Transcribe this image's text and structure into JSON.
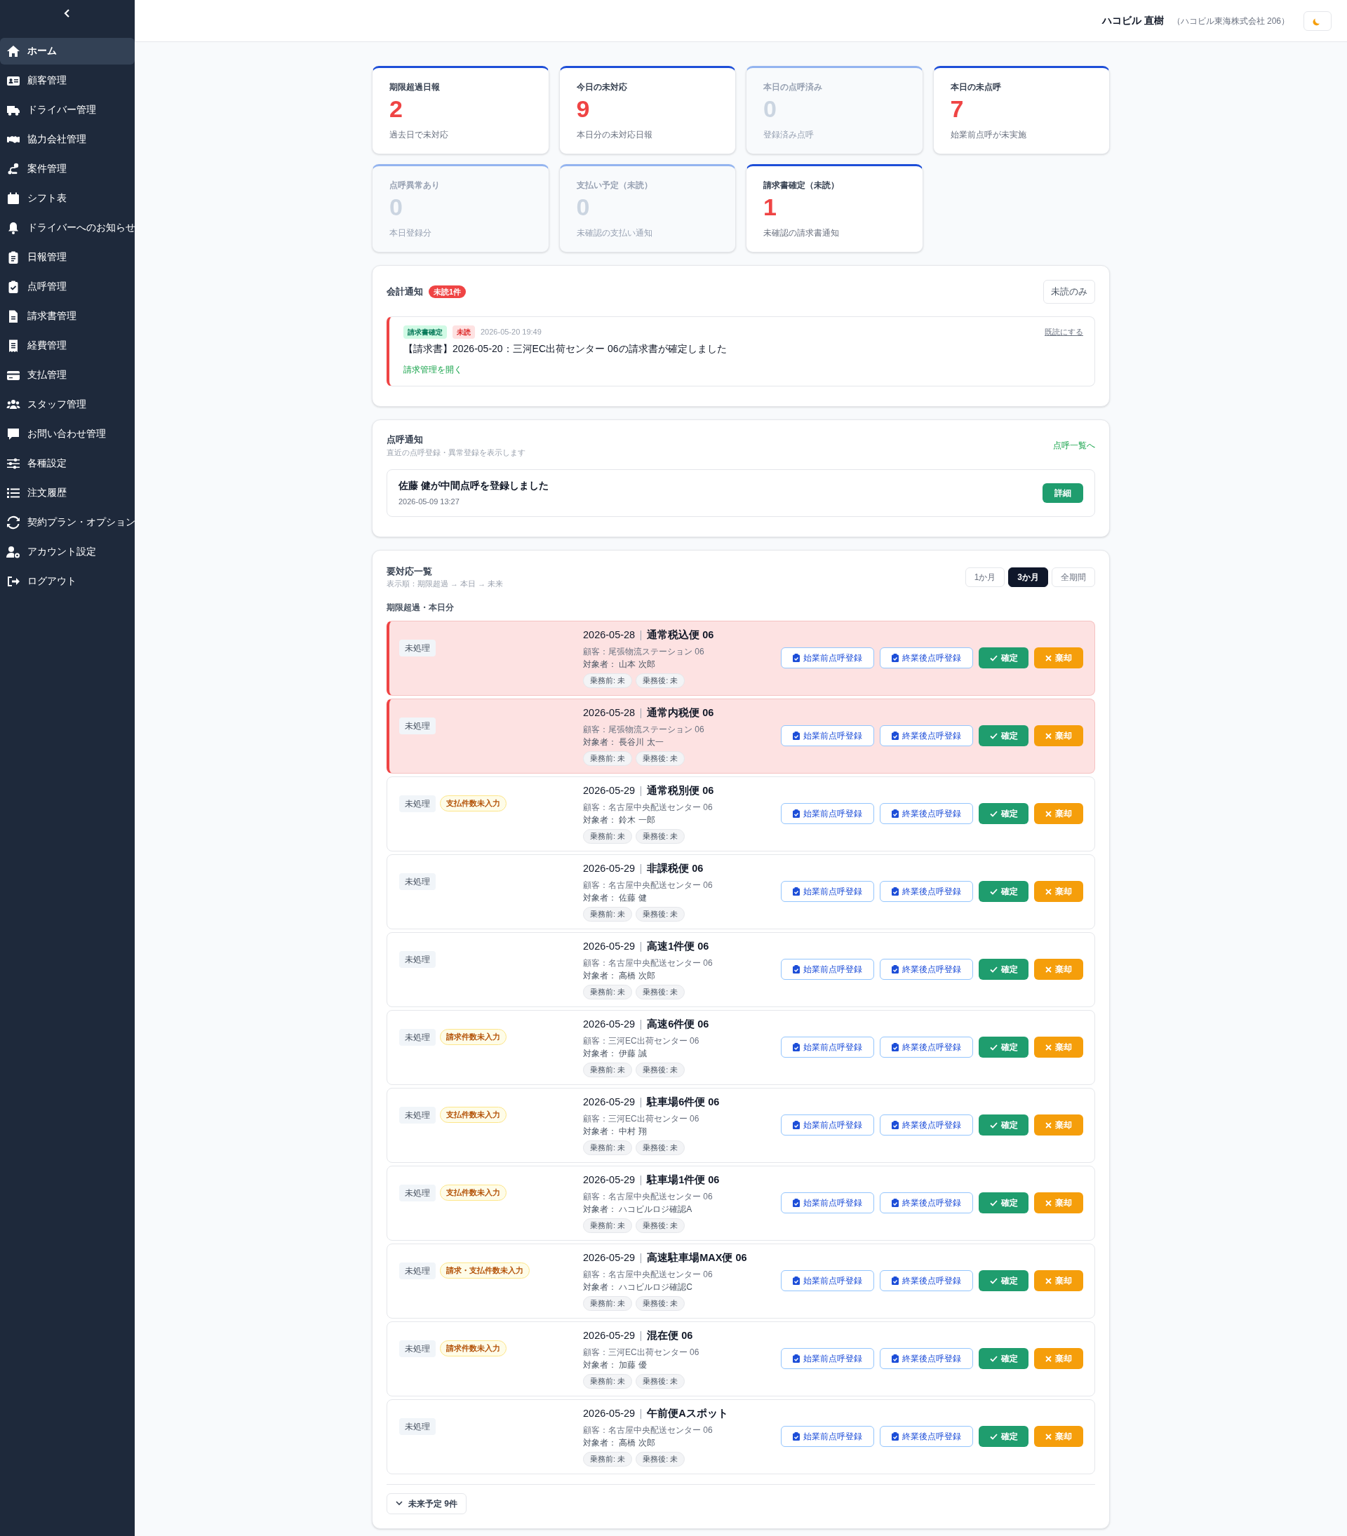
{
  "sidebar": {
    "items": [
      {
        "label": "ホーム",
        "selected": true
      },
      {
        "label": "顧客管理",
        "selected": false
      },
      {
        "label": "ドライバー管理",
        "selected": false
      },
      {
        "label": "協力会社管理",
        "selected": false
      },
      {
        "label": "案件管理",
        "selected": false
      },
      {
        "label": "シフト表",
        "selected": false
      },
      {
        "label": "ドライバーへのお知らせ",
        "selected": false
      },
      {
        "label": "日報管理",
        "selected": false
      },
      {
        "label": "点呼管理",
        "selected": false
      },
      {
        "label": "請求書管理",
        "selected": false
      },
      {
        "label": "経費管理",
        "selected": false
      },
      {
        "label": "支払管理",
        "selected": false
      },
      {
        "label": "スタッフ管理",
        "selected": false
      },
      {
        "label": "お問い合わせ管理",
        "selected": false
      },
      {
        "label": "各種設定",
        "selected": false
      },
      {
        "label": "注文履歴",
        "selected": false
      },
      {
        "label": "契約プラン・オプション",
        "selected": false
      },
      {
        "label": "アカウント設定",
        "selected": false
      },
      {
        "label": "ログアウト",
        "selected": false
      }
    ]
  },
  "header": {
    "user_name": "ハコビル 直樹",
    "company": "（ハコビル東海株式会社 206）"
  },
  "stats": [
    {
      "label": "期限超過日報",
      "value": "2",
      "note": "過去日で未対応",
      "active": true
    },
    {
      "label": "今日の未対応",
      "value": "9",
      "note": "本日分の未対応日報",
      "active": true
    },
    {
      "label": "本日の点呼済み",
      "value": "0",
      "note": "登録済み点呼",
      "active": false
    },
    {
      "label": "本日の未点呼",
      "value": "7",
      "note": "始業前点呼が未実施",
      "active": true
    },
    {
      "label": "点呼異常あり",
      "value": "0",
      "note": "本日登録分",
      "active": false
    },
    {
      "label": "支払い予定（未読）",
      "value": "0",
      "note": "未確認の支払い通知",
      "active": false
    },
    {
      "label": "請求書確定（未読）",
      "value": "1",
      "note": "未確認の請求書通知",
      "active": true
    }
  ],
  "accounting": {
    "title": "会計通知",
    "badge": "未読1件",
    "filter_button": "未読のみ",
    "notifications": [
      {
        "unread": true,
        "tags": [
          "請求書確定",
          "未読"
        ],
        "time": "2026-05-20 19:49",
        "mark_read": "既読にする",
        "message": "【請求書】2026-05-20：三河EC出荷センター 06の請求書が確定しました",
        "link": "請求管理を開く"
      }
    ]
  },
  "tenko": {
    "title": "点呼通知",
    "subtitle": "直近の点呼登録・異常登録を表示します",
    "link": "点呼一覧へ",
    "items": [
      {
        "text": "佐藤 健が中間点呼を登録しました",
        "time": "2026-05-09 13:27",
        "button": "詳細"
      }
    ]
  },
  "todo": {
    "title": "要対応一覧",
    "subtitle": "表示順：期限超過 → 本日 → 未来",
    "periods": [
      {
        "label": "1か月",
        "selected": false
      },
      {
        "label": "3か月",
        "selected": true
      },
      {
        "label": "全期間",
        "selected": false
      }
    ],
    "section": "期限超過・本日分",
    "rows": [
      {
        "overdue": true,
        "status": "未処理",
        "date": "2026-05-28",
        "title": "通常税込便 06",
        "customer": "顧客：尾張物流ステーション 06",
        "target": "対象者： 山本 次郎",
        "chips": [
          "乗務前: 未",
          "乗務後: 未"
        ],
        "actions": [
          "始業前点呼登録",
          "終業後点呼登録",
          "確定",
          "棄却"
        ]
      },
      {
        "overdue": true,
        "status": "未処理",
        "date": "2026-05-28",
        "title": "通常内税便 06",
        "customer": "顧客：尾張物流ステーション 06",
        "target": "対象者： 長谷川 太一",
        "chips": [
          "乗務前: 未",
          "乗務後: 未"
        ],
        "actions": [
          "始業前点呼登録",
          "終業後点呼登録",
          "確定",
          "棄却"
        ]
      },
      {
        "overdue": false,
        "status": "未処理",
        "tag": "支払件数未入力",
        "date": "2026-05-29",
        "title": "通常税別便 06",
        "customer": "顧客：名古屋中央配送センター 06",
        "target": "対象者： 鈴木 一郎",
        "chips": [
          "乗務前: 未",
          "乗務後: 未"
        ],
        "actions": [
          "始業前点呼登録",
          "終業後点呼登録",
          "確定",
          "棄却"
        ]
      },
      {
        "overdue": false,
        "status": "未処理",
        "date": "2026-05-29",
        "title": "非課税便 06",
        "customer": "顧客：名古屋中央配送センター 06",
        "target": "対象者： 佐藤 健",
        "chips": [
          "乗務前: 未",
          "乗務後: 未"
        ],
        "actions": [
          "始業前点呼登録",
          "終業後点呼登録",
          "確定",
          "棄却"
        ]
      },
      {
        "overdue": false,
        "status": "未処理",
        "date": "2026-05-29",
        "title": "高速1件便 06",
        "customer": "顧客：名古屋中央配送センター 06",
        "target": "対象者： 高橋 次郎",
        "chips": [
          "乗務前: 未",
          "乗務後: 未"
        ],
        "actions": [
          "始業前点呼登録",
          "終業後点呼登録",
          "確定",
          "棄却"
        ]
      },
      {
        "overdue": false,
        "status": "未処理",
        "tag": "請求件数未入力",
        "date": "2026-05-29",
        "title": "高速6件便 06",
        "customer": "顧客：三河EC出荷センター 06",
        "target": "対象者： 伊藤 誠",
        "chips": [
          "乗務前: 未",
          "乗務後: 未"
        ],
        "actions": [
          "始業前点呼登録",
          "終業後点呼登録",
          "確定",
          "棄却"
        ]
      },
      {
        "overdue": false,
        "status": "未処理",
        "tag": "支払件数未入力",
        "date": "2026-05-29",
        "title": "駐車場6件便 06",
        "customer": "顧客：三河EC出荷センター 06",
        "target": "対象者： 中村 翔",
        "chips": [
          "乗務前: 未",
          "乗務後: 未"
        ],
        "actions": [
          "始業前点呼登録",
          "終業後点呼登録",
          "確定",
          "棄却"
        ]
      },
      {
        "overdue": false,
        "status": "未処理",
        "tag": "支払件数未入力",
        "date": "2026-05-29",
        "title": "駐車場1件便 06",
        "customer": "顧客：名古屋中央配送センター 06",
        "target": "対象者： ハコビルロジ確認A",
        "chips": [
          "乗務前: 未",
          "乗務後: 未"
        ],
        "actions": [
          "始業前点呼登録",
          "終業後点呼登録",
          "確定",
          "棄却"
        ]
      },
      {
        "overdue": false,
        "status": "未処理",
        "tag": "請求・支払件数未入力",
        "date": "2026-05-29",
        "title": "高速駐車場MAX便 06",
        "customer": "顧客：名古屋中央配送センター 06",
        "target": "対象者： ハコビルロジ確認C",
        "chips": [
          "乗務前: 未",
          "乗務後: 未"
        ],
        "actions": [
          "始業前点呼登録",
          "終業後点呼登録",
          "確定",
          "棄却"
        ]
      },
      {
        "overdue": false,
        "status": "未処理",
        "tag": "請求件数未入力",
        "date": "2026-05-29",
        "title": "混在便 06",
        "customer": "顧客：三河EC出荷センター 06",
        "target": "対象者： 加藤 優",
        "chips": [
          "乗務前: 未",
          "乗務後: 未"
        ],
        "actions": [
          "始業前点呼登録",
          "終業後点呼登録",
          "確定",
          "棄却"
        ]
      },
      {
        "overdue": false,
        "status": "未処理",
        "date": "2026-05-29",
        "title": "午前便Aスポット",
        "customer": "顧客：名古屋中央配送センター 06",
        "target": "対象者： 高橋 次郎",
        "chips": [
          "乗務前: 未",
          "乗務後: 未"
        ],
        "actions": [
          "始業前点呼登録",
          "終業後点呼登録",
          "確定",
          "棄却"
        ]
      }
    ],
    "future_button": "未来予定 9件"
  }
}
